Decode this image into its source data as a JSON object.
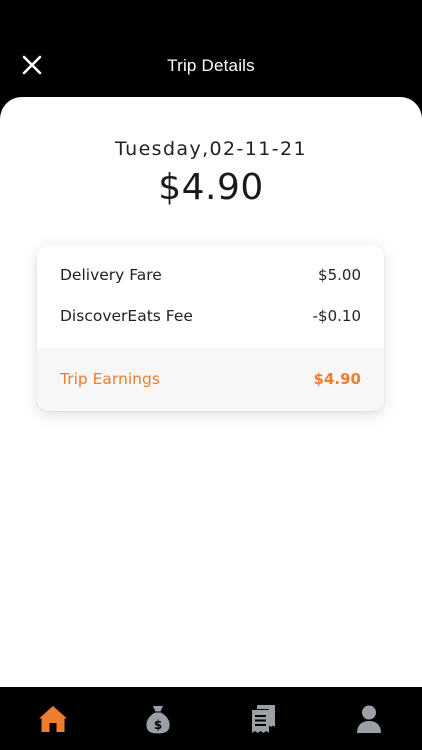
{
  "header": {
    "title": "Trip Details",
    "close_icon": "close-icon"
  },
  "trip": {
    "date": "Tuesday,02-11-21",
    "total": "$4.90"
  },
  "breakdown": {
    "rows": [
      {
        "label": "Delivery Fare",
        "value": "$5.00"
      },
      {
        "label": "DiscoverEats Fee",
        "value": "-$0.10"
      }
    ],
    "earnings": {
      "label": "Trip Earnings",
      "value": "$4.90"
    }
  },
  "tabbar": {
    "items": [
      {
        "icon": "home-icon",
        "active": true
      },
      {
        "icon": "money-bag-icon",
        "active": false
      },
      {
        "icon": "receipt-icon",
        "active": false
      },
      {
        "icon": "user-icon",
        "active": false
      }
    ]
  },
  "colors": {
    "accent": "#ee7d2e",
    "inactive_icon": "#9aa0a6",
    "background": "#000000",
    "sheet": "#ffffff"
  }
}
